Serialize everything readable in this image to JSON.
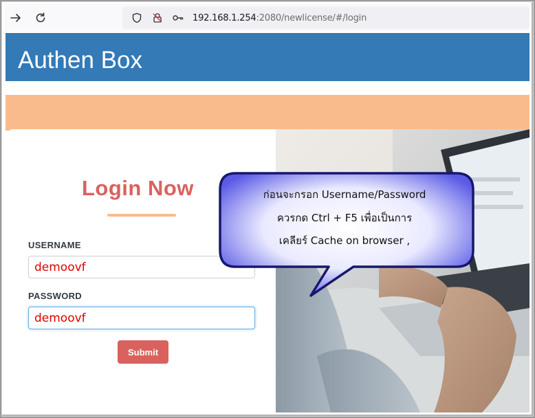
{
  "browser": {
    "url_host": "192.168.1.254",
    "url_rest": ":2080/newlicense/#/login"
  },
  "app": {
    "title": "Authen Box"
  },
  "login": {
    "heading": "Login Now",
    "username_label": "USERNAME",
    "username_value": "demoovf",
    "password_label": "PASSWORD",
    "password_value": "demoovf",
    "submit_label": "Submit"
  },
  "callout": {
    "line1": "ก่อนจะกรอก Username/Password",
    "line2": "ควรกด  Ctrl + F5  เพื่อเป็นการ",
    "line3": "เคลียร์ Cache on browser ,"
  },
  "colors": {
    "header": "#337ab7",
    "accent_orange": "#f9bb8c",
    "brand_red": "#d9625e",
    "input_text": "#e00000"
  }
}
